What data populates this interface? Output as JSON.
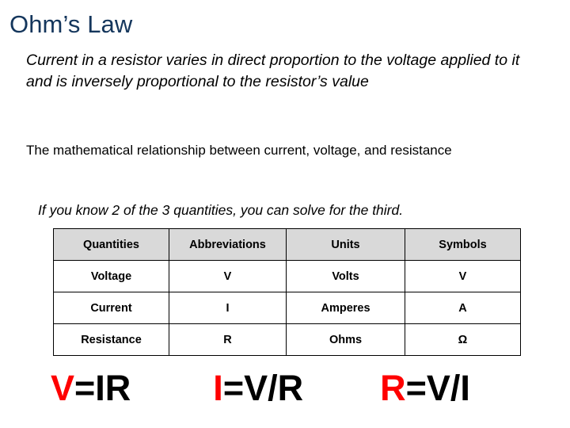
{
  "slide": {
    "title": "Ohm’s Law",
    "paragraphs": [
      {
        "id": "definition",
        "text": "Current in a resistor varies in direct proportion to the voltage applied to it and is inversely proportional to the resistor’s value"
      },
      {
        "id": "relationship",
        "text": "The mathematical relationship between current, voltage, and resistance"
      },
      {
        "id": "hint",
        "text": "If you know 2 of the 3 quantities, you can solve for the third."
      }
    ],
    "table": {
      "headers": [
        "Quantities",
        "Abbreviations",
        "Units",
        "Symbols"
      ],
      "rows": [
        [
          "Voltage",
          "V",
          "Volts",
          "V"
        ],
        [
          "Current",
          "I",
          "Amperes",
          "A"
        ],
        [
          "Resistance",
          "R",
          "Ohms",
          "Ω"
        ]
      ]
    },
    "formulas": [
      {
        "lead": "V",
        "rest": "=IR"
      },
      {
        "lead": "I",
        "rest": "=V/R"
      },
      {
        "lead": "R",
        "rest": "=V/I"
      }
    ],
    "colors": {
      "title": "#14365C",
      "formula_lead": "#FF0000",
      "formula_rest": "#000000",
      "table_header_bg": "#D9D9D9",
      "table_border": "#000000",
      "background": "#FFFFFF"
    }
  }
}
